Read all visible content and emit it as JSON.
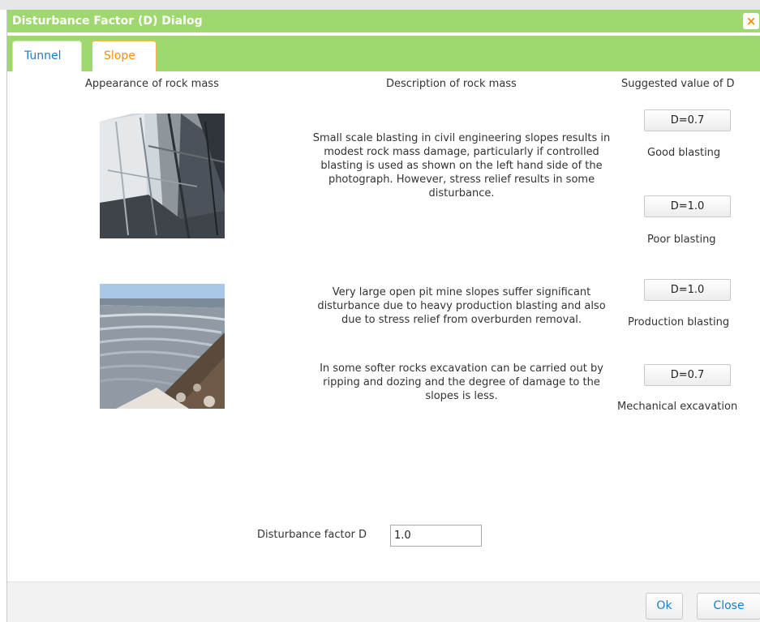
{
  "window": {
    "background_text": "Tunnel  Slope  Disturbance factor D",
    "title": "Disturbance Factor (D) Dialog",
    "close_glyph": "×",
    "close_icon": "close-icon"
  },
  "tabs": [
    {
      "label": "Tunnel",
      "active": false
    },
    {
      "label": "Slope",
      "active": true
    }
  ],
  "headers": {
    "appearance": "Appearance of rock mass",
    "description": "Description of rock mass",
    "suggested": "Suggested value of D"
  },
  "rows": [
    {
      "photo": "rock-cut-slope-photo",
      "descriptions": [
        "Small scale blasting in civil engineering slopes results in modest rock mass damage, particularly if controlled blasting is used as shown on the left hand side of the photograph. However, stress relief results in some disturbance."
      ],
      "options": [
        {
          "button": "D=0.7",
          "label": "Good blasting"
        },
        {
          "button": "D=1.0",
          "label": "Poor blasting"
        }
      ]
    },
    {
      "photo": "open-pit-mine-photo",
      "descriptions": [
        "Very large open pit mine slopes suffer significant disturbance due to heavy production blasting and also due to stress relief from overburden removal.",
        "In some softer rocks excavation can be carried out by ripping and dozing and the degree of damage to the slopes is less."
      ],
      "options": [
        {
          "button": "D=1.0",
          "label": "Production blasting"
        },
        {
          "button": "D=0.7",
          "label": "Mechanical excavation"
        }
      ]
    }
  ],
  "factor": {
    "label": "Disturbance factor D",
    "value": "1.0"
  },
  "footer": {
    "ok_label": "Ok",
    "close_label": "Close"
  },
  "colors": {
    "titlebar": "#9fd86e",
    "tab_tunnel": "#1f7dbf",
    "tab_slope_active": "#f29000",
    "button_text": "#1f7dbf"
  }
}
